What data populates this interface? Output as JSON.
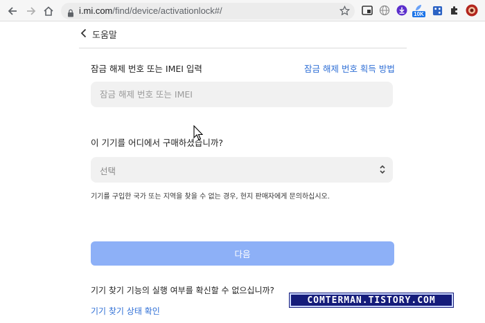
{
  "browser": {
    "url_host": "i.mi.com",
    "url_path": "/find/device/activationlock#/",
    "extension_badge": "10K"
  },
  "page": {
    "back_label": "도움말",
    "unlock_label": "잠금 해제 번호 또는 IMEI 입력",
    "unlock_help_link": "잠금 해제 번호 획득 방법",
    "unlock_placeholder": "잠금 해제 번호 또는 IMEI",
    "purchase_question": "이 기기를 어디에서 구매하셨습니까?",
    "purchase_select_value": "선택",
    "purchase_note": "기기를 구입한 국가 또는 지역을 찾을 수 없는 경우, 현지 판매자에게 문의하십시오.",
    "next_button": "다음",
    "find_device_question": "기기 찾기 기능의 실행 여부를 확신할 수 없으십니까?",
    "find_device_link": "기기 찾기 상태 확인"
  },
  "watermark": "COMTERMAN.TISTORY.COM",
  "colors": {
    "link": "#2f6fd6",
    "button_disabled": "#8db0f7",
    "field_bg": "#f1f1f1",
    "watermark_bg": "#151c7a"
  }
}
